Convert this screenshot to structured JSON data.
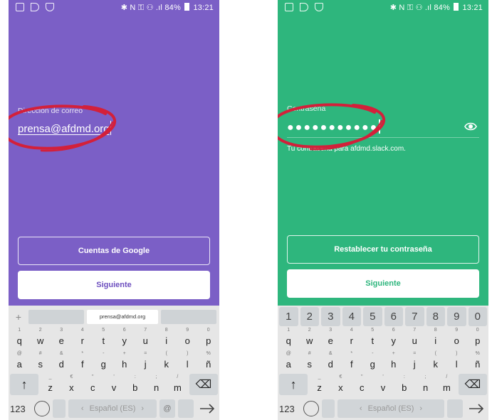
{
  "statusbar": {
    "left_icons": [
      "image-icon",
      "play-store-icon",
      "shield-icon"
    ],
    "right_text": "✱ N  ⚿ ⚇ .ıl 84%",
    "time": "13:21",
    "battery": "84%"
  },
  "left_screen": {
    "bg_color": "#7b5fc6",
    "field_label": "Dirección de correo",
    "email_value": "prensa@afdmd.org",
    "google_button": "Cuentas de Google",
    "next_button": "Siguiente",
    "accent": "#6d4fbf",
    "suggestion": "prensa@afdmd.org"
  },
  "right_screen": {
    "bg_color": "#2eb67d",
    "field_label": "Contraseña",
    "password_value": "●●●●●●●●●●●",
    "helper": "Tu contraseña para afdmd.slack.com.",
    "reset_button": "Restablecer tu contraseña",
    "next_button": "Siguiente",
    "accent": "#2eb67d"
  },
  "keyboard": {
    "number_row": [
      "1",
      "2",
      "3",
      "4",
      "5",
      "6",
      "7",
      "8",
      "9",
      "0"
    ],
    "row1": [
      {
        "key": "q",
        "hint": "1"
      },
      {
        "key": "w",
        "hint": "2"
      },
      {
        "key": "e",
        "hint": "3"
      },
      {
        "key": "r",
        "hint": "4"
      },
      {
        "key": "t",
        "hint": "5"
      },
      {
        "key": "y",
        "hint": "6"
      },
      {
        "key": "u",
        "hint": "7"
      },
      {
        "key": "i",
        "hint": "8"
      },
      {
        "key": "o",
        "hint": "9"
      },
      {
        "key": "p",
        "hint": "0"
      }
    ],
    "row2": [
      {
        "key": "a",
        "hint": "@"
      },
      {
        "key": "s",
        "hint": "#"
      },
      {
        "key": "d",
        "hint": "&"
      },
      {
        "key": "f",
        "hint": "*"
      },
      {
        "key": "g",
        "hint": "-"
      },
      {
        "key": "h",
        "hint": "+"
      },
      {
        "key": "j",
        "hint": "="
      },
      {
        "key": "k",
        "hint": "("
      },
      {
        "key": "l",
        "hint": ")"
      },
      {
        "key": "ñ",
        "hint": "%"
      }
    ],
    "row3": [
      {
        "key": "z",
        "hint": "_"
      },
      {
        "key": "x",
        "hint": "€"
      },
      {
        "key": "c",
        "hint": "\""
      },
      {
        "key": "v",
        "hint": "'"
      },
      {
        "key": "b",
        "hint": ":"
      },
      {
        "key": "n",
        "hint": ";"
      },
      {
        "key": "m",
        "hint": "/"
      }
    ],
    "shift": "↑",
    "backspace": "⌫",
    "k123": "123",
    "space_label": "Español (ES)",
    "at_key": "@",
    "enter": "→",
    "plus": "+"
  },
  "colors": {
    "circle_red": "#d3203a",
    "keyboard_bg": "#e6e6e6"
  }
}
